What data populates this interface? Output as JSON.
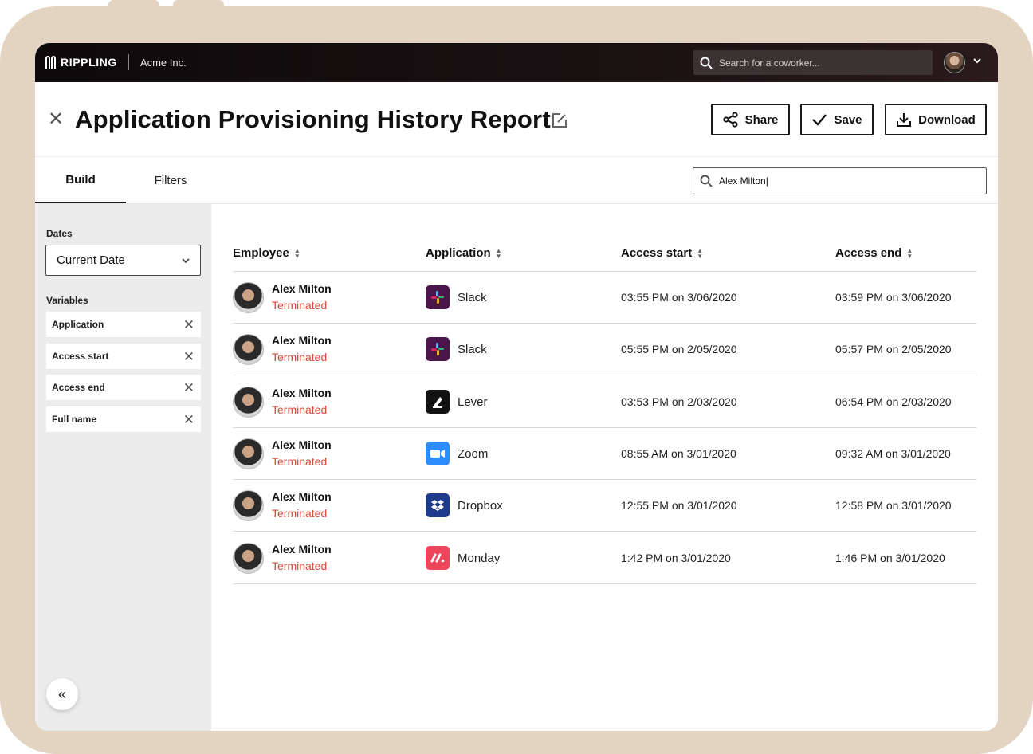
{
  "topbar": {
    "brand": "RIPPLING",
    "company": "Acme Inc.",
    "search_placeholder": "Search for a coworker..."
  },
  "header": {
    "title": "Application Provisioning History Report",
    "share_label": "Share",
    "save_label": "Save",
    "download_label": "Download"
  },
  "tabs": {
    "build": "Build",
    "filters": "Filters"
  },
  "report_search": {
    "value": "Alex Milton|"
  },
  "sidebar": {
    "dates_label": "Dates",
    "date_value": "Current Date",
    "variables_label": "Variables",
    "variables": [
      "Application",
      "Access start",
      "Access end",
      "Full name"
    ]
  },
  "table": {
    "columns": [
      "Employee",
      "Application",
      "Access start",
      "Access end"
    ],
    "rows": [
      {
        "name": "Alex Milton",
        "status": "Terminated",
        "app": "Slack",
        "start": "03:55 PM on 3/06/2020",
        "end": "03:59 PM on 3/06/2020"
      },
      {
        "name": "Alex Milton",
        "status": "Terminated",
        "app": "Slack",
        "start": "05:55 PM on 2/05/2020",
        "end": "05:57 PM on 2/05/2020"
      },
      {
        "name": "Alex Milton",
        "status": "Terminated",
        "app": "Lever",
        "start": "03:53 PM on 2/03/2020",
        "end": "06:54 PM on 2/03/2020"
      },
      {
        "name": "Alex Milton",
        "status": "Terminated",
        "app": "Zoom",
        "start": "08:55 AM on 3/01/2020",
        "end": "09:32 AM on 3/01/2020"
      },
      {
        "name": "Alex Milton",
        "status": "Terminated",
        "app": "Dropbox",
        "start": "12:55 PM on 3/01/2020",
        "end": "12:58 PM on 3/01/2020"
      },
      {
        "name": "Alex Milton",
        "status": "Terminated",
        "app": "Monday",
        "start": "1:42 PM on 3/01/2020",
        "end": "1:46 PM on 3/01/2020"
      }
    ]
  },
  "colors": {
    "terminated": "#d9483b",
    "slack": "#4a154b",
    "lever": "#111111",
    "zoom": "#2d8cff",
    "dropbox": "#1e3a8a",
    "monday": "#f0445b"
  }
}
